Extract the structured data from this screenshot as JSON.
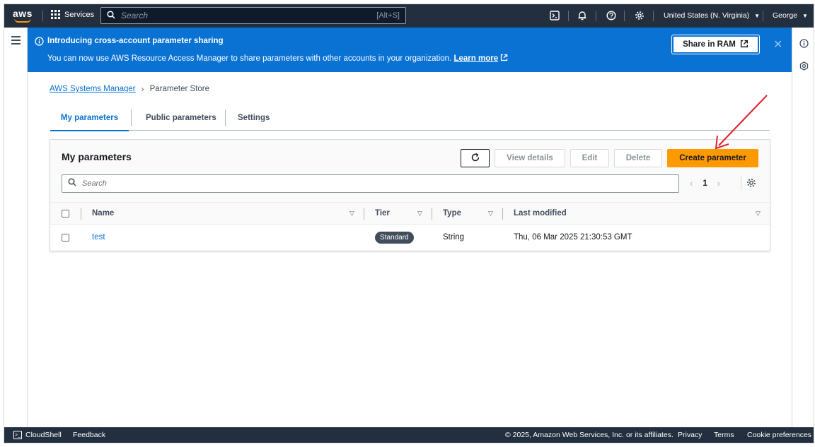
{
  "topnav": {
    "logo_text": "aws",
    "services_label": "Services",
    "search_placeholder": "Search",
    "search_shortcut": "[Alt+S]",
    "region": "United States (N. Virginia)",
    "user": "George"
  },
  "banner": {
    "title": "Introducing cross-account parameter sharing",
    "message": "You can now use AWS Resource Access Manager to share parameters with other accounts in your organization.",
    "learn_more": "Learn more",
    "share_button": "Share in RAM"
  },
  "breadcrumb": {
    "parent": "AWS Systems Manager",
    "current": "Parameter Store"
  },
  "tabs": [
    {
      "label": "My parameters",
      "active": true
    },
    {
      "label": "Public parameters",
      "active": false
    },
    {
      "label": "Settings",
      "active": false
    }
  ],
  "container": {
    "title": "My parameters",
    "buttons": {
      "view_details": "View details",
      "edit": "Edit",
      "delete": "Delete",
      "create": "Create parameter"
    },
    "search_placeholder": "Search",
    "page_number": "1"
  },
  "table": {
    "columns": [
      "Name",
      "Tier",
      "Type",
      "Last modified"
    ],
    "rows": [
      {
        "name": "test",
        "tier": "Standard",
        "type": "String",
        "last_modified": "Thu, 06 Mar 2025 21:30:53 GMT"
      }
    ]
  },
  "footer": {
    "cloudshell": "CloudShell",
    "feedback": "Feedback",
    "copyright": "© 2025, Amazon Web Services, Inc. or its affiliates.",
    "privacy": "Privacy",
    "terms": "Terms",
    "cookies": "Cookie preferences"
  },
  "colors": {
    "nav_bg": "#232f3e",
    "banner_bg": "#0972d3",
    "primary_button": "#ff9900",
    "link": "#0972d3",
    "annotation_arrow": "#e0202a"
  },
  "icons": [
    "aws-logo",
    "grid-icon",
    "search-icon",
    "cloudshell-icon",
    "bell-icon",
    "help-icon",
    "gear-icon",
    "info-icon",
    "external-link-icon",
    "close-icon",
    "hamburger-icon",
    "refresh-icon",
    "chevron-left-icon",
    "chevron-right-icon",
    "sort-icon"
  ]
}
